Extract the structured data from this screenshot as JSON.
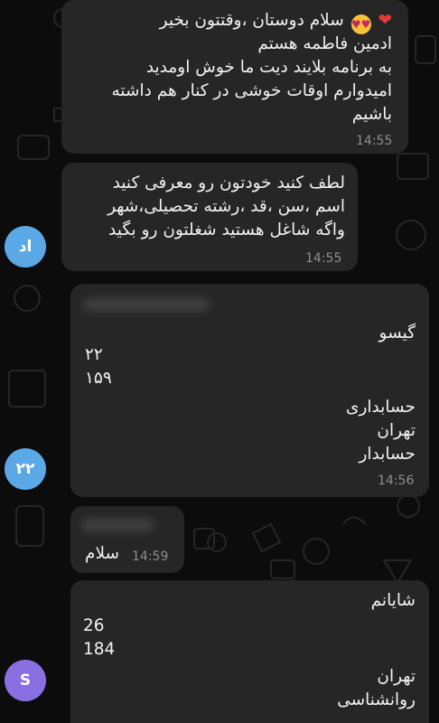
{
  "messages": [
    {
      "lines": [
        "سلام دوستان ،وقتتون بخیر",
        "ادمین فاطمه هستم",
        "به برنامه بلایند دیت ما خوش اومدید",
        "امیدوارم اوقات خوشی در کنار هم داشته",
        "باشیم"
      ],
      "emoji": {
        "heart": "❤",
        "smiley": "😍"
      },
      "time": "14:55"
    },
    {
      "lines": [
        "لطف کنید خودتون رو معرفی کنید",
        "اسم ،سن ،قد ،رشته تحصیلی،شهر",
        "واگه شاغل هستید شغلتون رو بگید"
      ],
      "time": "14:55",
      "avatar": {
        "initials": "اد",
        "color": "#5aa9e6"
      }
    },
    {
      "lines": [
        "گیسو",
        "۲۲",
        "۱۵۹",
        "حسابداری",
        "تهران",
        "حسابدار"
      ],
      "time": "14:56",
      "avatar": {
        "initials": "۲۲",
        "color": "#5aa9e6"
      }
    },
    {
      "text": "سلام",
      "time": "14:59"
    },
    {
      "lines": [
        "شایانم",
        "26",
        "184",
        "تهران",
        "روانشناسی"
      ],
      "avatar": {
        "initials": "S",
        "color": "#8a6fe3"
      }
    }
  ],
  "colors": {
    "bubble": "#262626",
    "background": "#0c0c0c",
    "time": "#8d8d8d"
  }
}
